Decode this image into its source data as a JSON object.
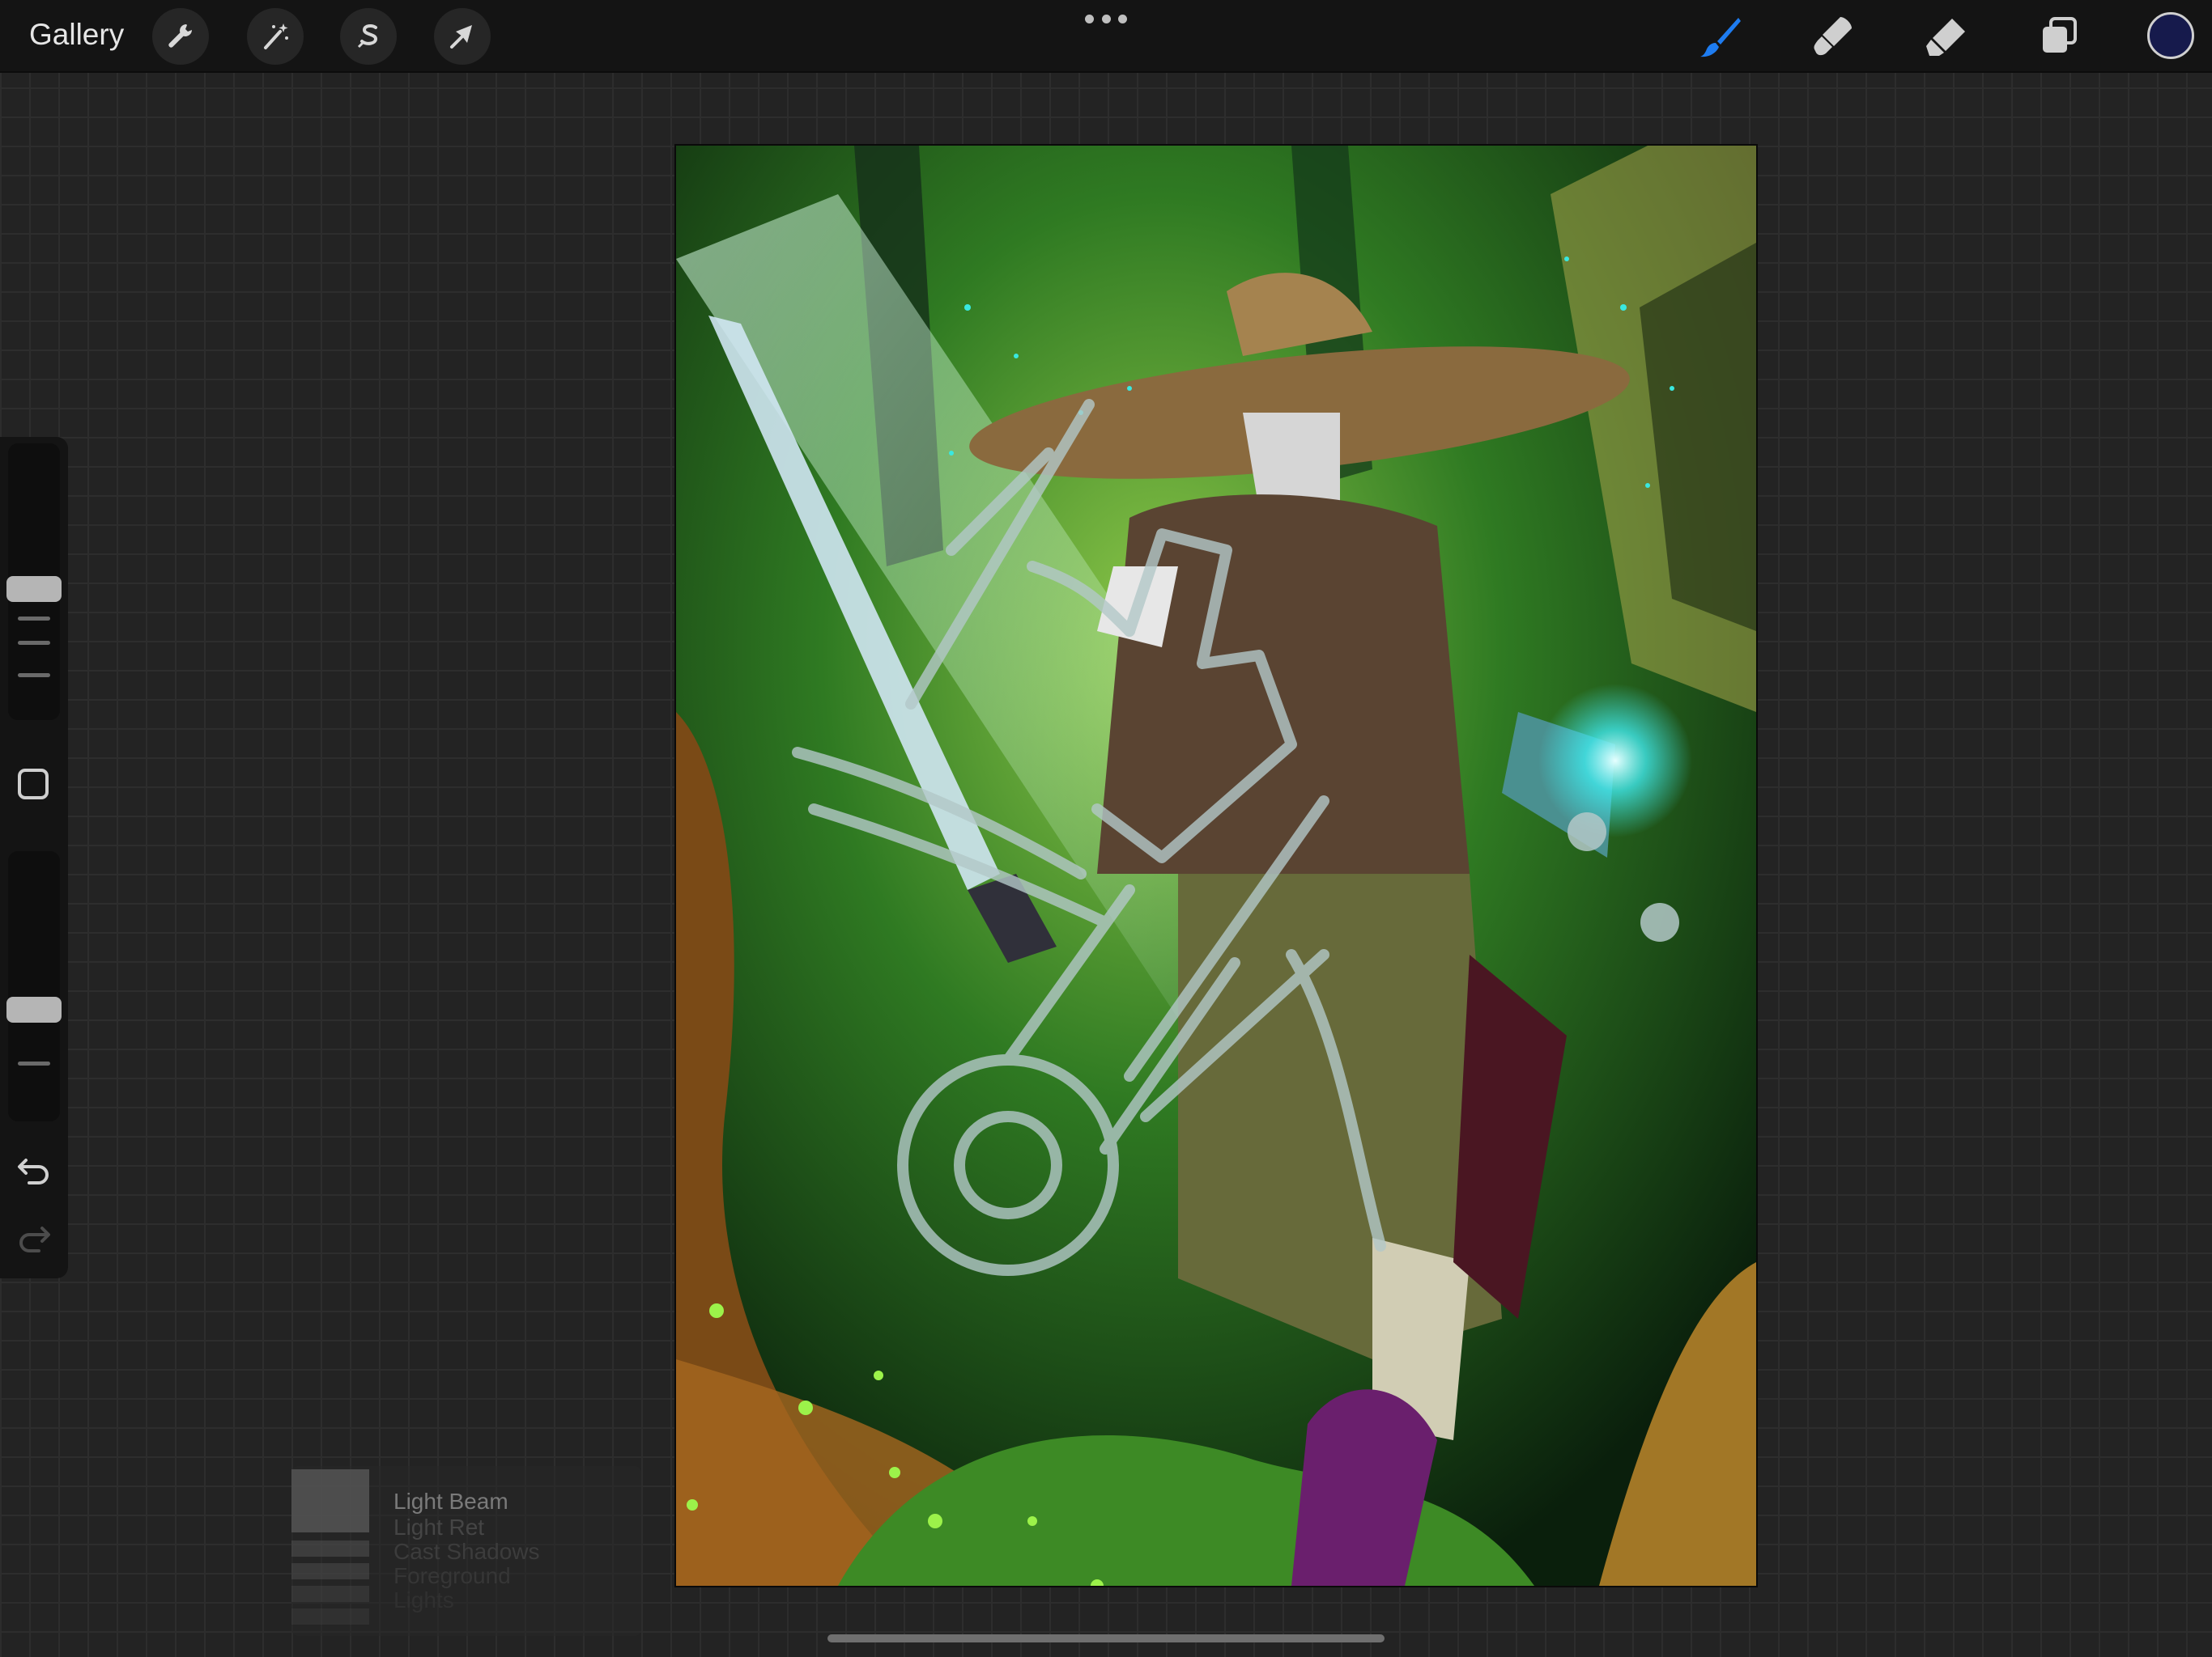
{
  "app": "Procreate",
  "topbar": {
    "gallery_label": "Gallery",
    "left_tools": [
      {
        "name": "actions",
        "icon": "wrench-icon"
      },
      {
        "name": "adjustments",
        "icon": "magic-wand-icon"
      },
      {
        "name": "selection",
        "icon": "selection-s-icon"
      },
      {
        "name": "transform",
        "icon": "transform-arrow-icon"
      }
    ],
    "more_icon": "more-dots-icon",
    "right_tools": [
      {
        "name": "brush",
        "icon": "brush-icon",
        "active": true,
        "color": "#1e7cf0"
      },
      {
        "name": "smudge",
        "icon": "smudge-icon",
        "active": false
      },
      {
        "name": "eraser",
        "icon": "eraser-icon",
        "active": false
      },
      {
        "name": "layers",
        "icon": "layers-icon",
        "active": false
      }
    ],
    "current_color": "#161a4c"
  },
  "sidebar": {
    "brush_size_level": 0.55,
    "opacity_level": 0.62,
    "modify_icon": "modify-square-icon",
    "undo_icon": "undo-icon",
    "redo_icon": "redo-icon"
  },
  "canvas": {
    "content": "digital painting of a warrior with a straw hat and sword in a glowing green forest"
  },
  "layers_quickview": {
    "layers": [
      "Light Beam",
      "Light Ret",
      "Cast Shadows",
      "Foreground",
      "Lights"
    ]
  }
}
